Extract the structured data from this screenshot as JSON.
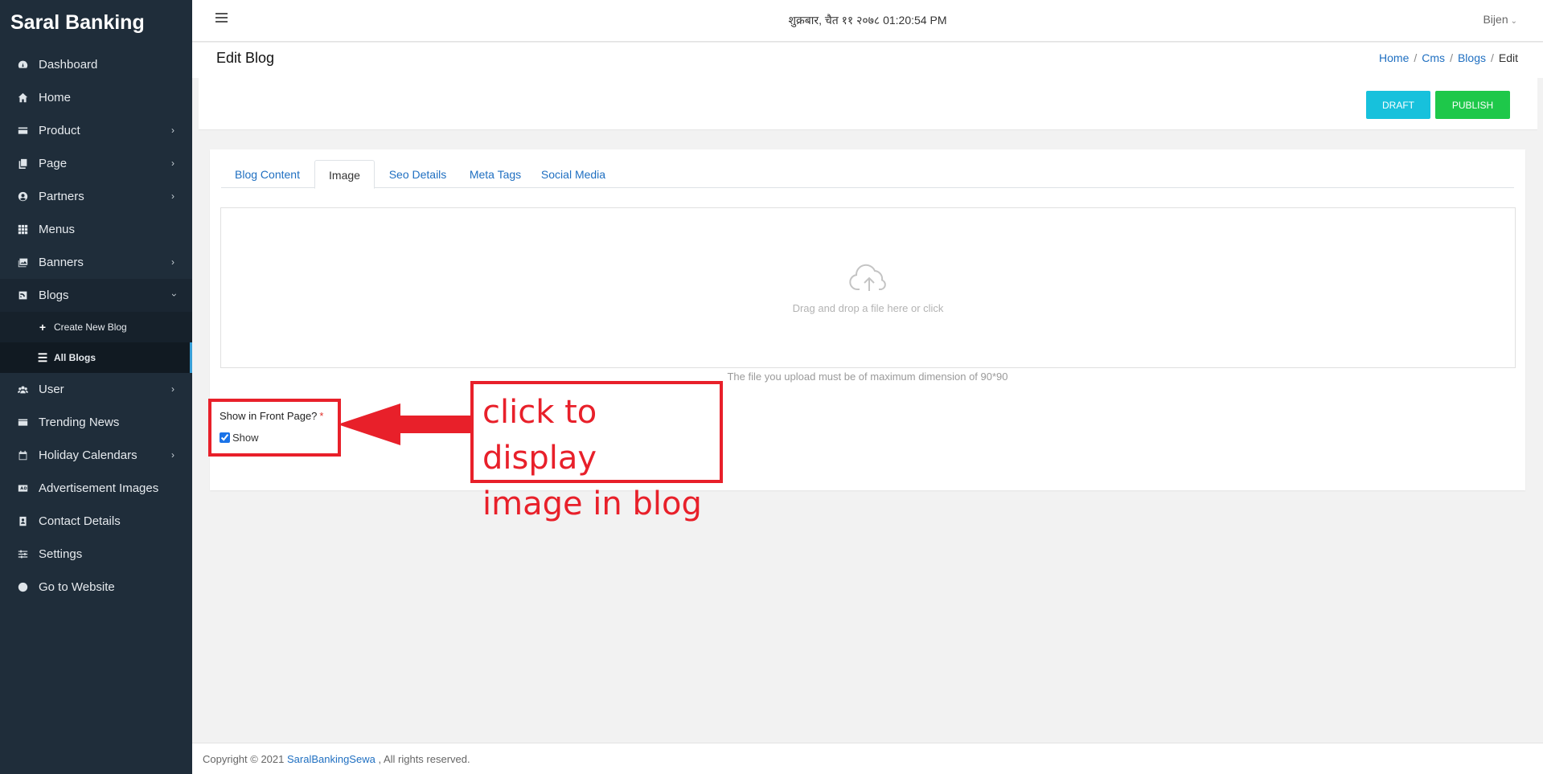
{
  "sidebar": {
    "brand": "Saral Banking",
    "items": [
      {
        "label": "Dashboard"
      },
      {
        "label": "Home"
      },
      {
        "label": "Product"
      },
      {
        "label": "Page"
      },
      {
        "label": "Partners"
      },
      {
        "label": "Menus"
      },
      {
        "label": "Banners"
      },
      {
        "label": "Blogs"
      },
      {
        "label": "User"
      },
      {
        "label": "Trending News"
      },
      {
        "label": "Holiday Calendars"
      },
      {
        "label": "Advertisement Images"
      },
      {
        "label": "Contact Details"
      },
      {
        "label": "Settings"
      },
      {
        "label": "Go to Website"
      }
    ],
    "blogs_sub": [
      {
        "label": "Create New Blog"
      },
      {
        "label": "All Blogs"
      }
    ]
  },
  "topbar": {
    "datetime": "शुक्रबार, चैत ११ २०७८ 01:20:54 PM",
    "user": "Bijen"
  },
  "header": {
    "title": "Edit Blog",
    "breadcrumb": [
      "Home",
      "Cms",
      "Blogs",
      "Edit"
    ]
  },
  "actions": {
    "draft": "DRAFT",
    "publish": "PUBLISH"
  },
  "tabs": [
    "Blog Content",
    "Image",
    "Seo Details",
    "Meta Tags",
    "Social Media"
  ],
  "upload": {
    "dropzone_text": "Drag and drop a file here or click",
    "hint": "The file you upload must be of maximum dimension of 90*90"
  },
  "front_page": {
    "label": "Show in Front Page?",
    "required": "*",
    "checkbox_label": "Show",
    "checked": true
  },
  "annotation": {
    "line1": "click to display",
    "line2": "image in blog"
  },
  "footer": {
    "prefix": "Copyright © 2021 ",
    "link": "SaralBankingSewa",
    "suffix": " , All rights reserved."
  },
  "colors": {
    "sidebar_bg": "#1f2d3a",
    "draft_button": "#17c1dc",
    "publish_button": "#1ec84a",
    "link": "#1f6fc1",
    "annotation_red": "#e8202a"
  }
}
